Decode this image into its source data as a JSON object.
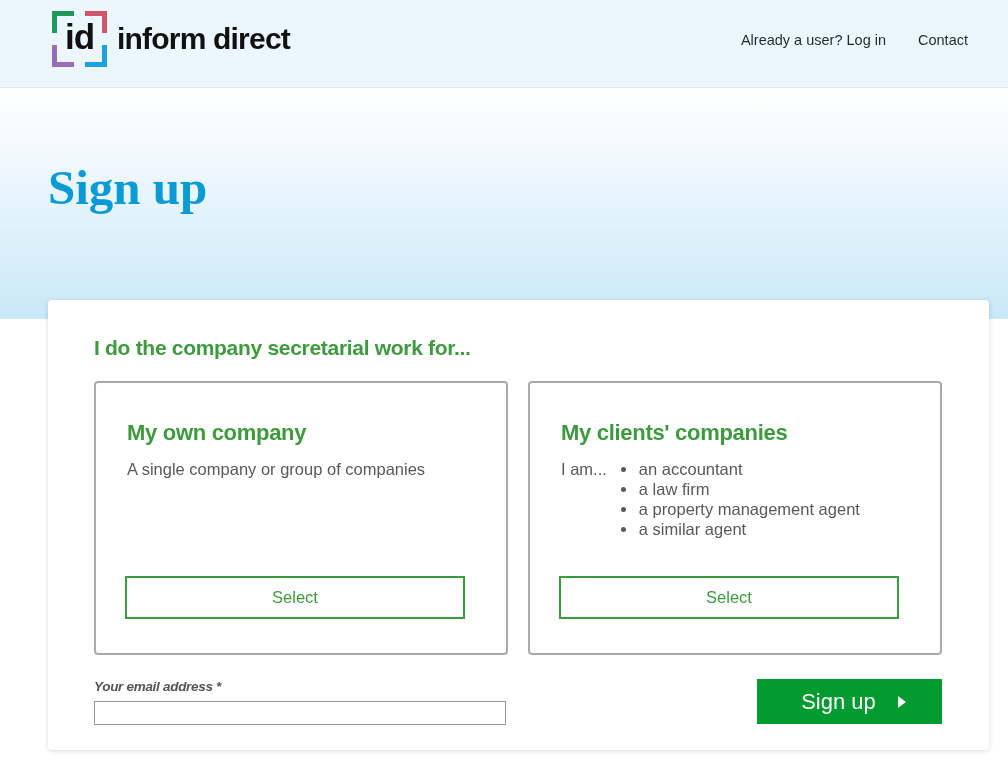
{
  "header": {
    "logo": {
      "mark": "id",
      "wordmark": "inform direct"
    },
    "nav": [
      {
        "label": "Already a user? Log in"
      },
      {
        "label": "Contact"
      }
    ]
  },
  "hero": {
    "title": "Sign up"
  },
  "form": {
    "heading": "I do the company secretarial work for...",
    "options": [
      {
        "kind": "plain",
        "title": "My own company",
        "description": "A single company or group of companies",
        "button": "Select"
      },
      {
        "kind": "list",
        "title": "My clients' companies",
        "lead": "I am...",
        "items": [
          "an accountant",
          "a law firm",
          "a property management agent",
          "a similar agent"
        ],
        "button": "Select"
      }
    ],
    "email": {
      "label": "Your email address *"
    },
    "submit": "Sign up"
  }
}
